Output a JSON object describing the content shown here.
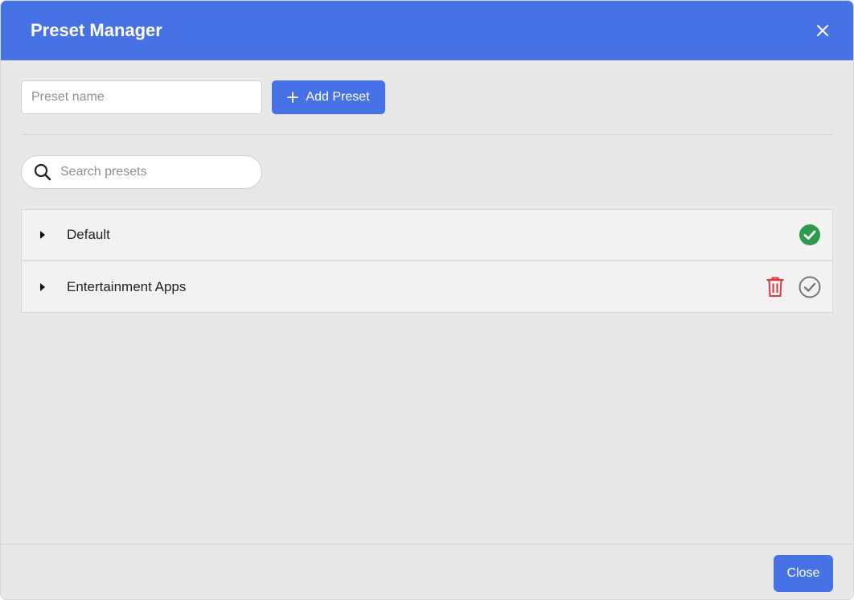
{
  "dialog": {
    "title": "Preset Manager",
    "close_icon": "close-icon"
  },
  "add_preset": {
    "input_placeholder": "Preset name",
    "input_value": "",
    "button_label": "Add Preset",
    "button_icon": "plus-icon"
  },
  "search": {
    "placeholder": "Search presets",
    "value": "",
    "icon": "search-icon"
  },
  "presets": [
    {
      "name": "Default",
      "active": true,
      "deletable": false
    },
    {
      "name": "Entertainment Apps",
      "active": false,
      "deletable": true
    }
  ],
  "footer": {
    "close_label": "Close"
  },
  "colors": {
    "accent": "#4772e6",
    "active_check": "#2e9b4a",
    "inactive_check": "#777777",
    "delete": "#d9363e",
    "background": "#e8e8e8"
  }
}
